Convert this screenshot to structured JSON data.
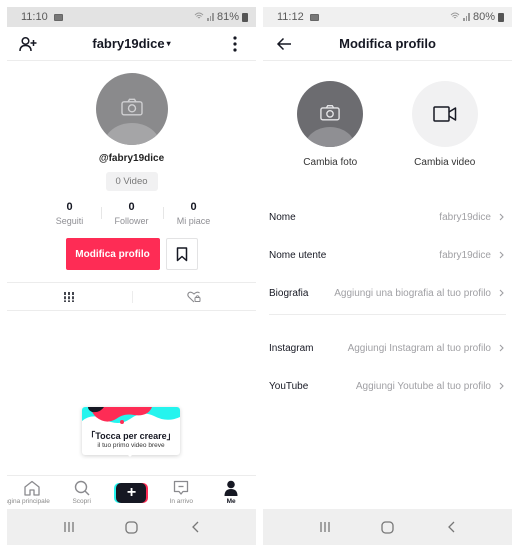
{
  "left_screen": {
    "statusbar": {
      "time": "11:10",
      "battery": "81%"
    },
    "header": {
      "username": "fabry19dice",
      "caret": "▾"
    },
    "profile": {
      "handle": "@fabry19dice",
      "video_count_label": "0 Video",
      "stats": [
        {
          "value": "0",
          "label": "Seguiti"
        },
        {
          "value": "0",
          "label": "Follower"
        },
        {
          "value": "0",
          "label": "Mi piace"
        }
      ],
      "edit_button": "Modifica profilo"
    },
    "tooltip": {
      "line1": "「Tocca per creare」",
      "line2": "il tuo primo video breve"
    },
    "bottom_nav": [
      {
        "icon": "home-icon",
        "label": "Pagina principale"
      },
      {
        "icon": "search-icon",
        "label": "Scopri"
      },
      {
        "icon": "create-icon",
        "label": "+"
      },
      {
        "icon": "inbox-icon",
        "label": "In arrivo"
      },
      {
        "icon": "profile-icon",
        "label": "Me"
      }
    ]
  },
  "right_screen": {
    "statusbar": {
      "time": "11:12",
      "battery": "80%"
    },
    "header": {
      "title": "Modifica profilo"
    },
    "media": {
      "photo_label": "Cambia foto",
      "video_label": "Cambia video"
    },
    "fields_group1": [
      {
        "label": "Nome",
        "value": "fabry19dice"
      },
      {
        "label": "Nome utente",
        "value": "fabry19dice"
      },
      {
        "label": "Biografia",
        "value": "Aggiungi una biografia al tuo profilo"
      }
    ],
    "fields_group2": [
      {
        "label": "Instagram",
        "value": "Aggiungi Instagram al tuo profilo"
      },
      {
        "label": "YouTube",
        "value": "Aggiungi Youtube al tuo profilo"
      }
    ]
  },
  "colors": {
    "accent": "#fe2c55",
    "create_cyan": "#25f4ee",
    "text_primary": "#161823",
    "text_secondary": "#8f8f94"
  }
}
